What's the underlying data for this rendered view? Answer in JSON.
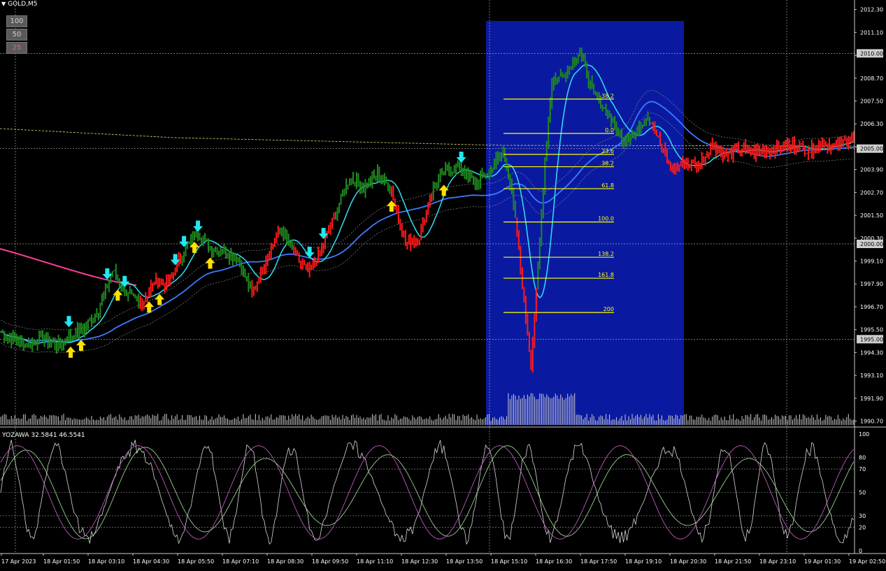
{
  "window": {
    "title": "GOLD,M5"
  },
  "level_buttons": [
    "100",
    "50",
    "25"
  ],
  "colors": {
    "background": "#000000",
    "bull_bar": "#1f8a1f",
    "bear_bar": "#ff1a1a",
    "fast_ma": "#32e0f0",
    "slow_ma": "#3b7cff",
    "pink_ma": "#ff3d9a",
    "highlight": "#0a1aa0",
    "fib": "#ffff00",
    "arrow_up": "#ffe000",
    "arrow_down": "#20e8f0",
    "volume": "#d0d0d0",
    "stoch_main": "#d8d8d8",
    "stoch_signal": "#cc66cc",
    "stoch_green": "#a8e8a0"
  },
  "price_axis": {
    "ticks": [
      "2012.30",
      "2011.10",
      "2009.90",
      "2008.70",
      "2007.50",
      "2006.30",
      "2005.10",
      "2003.90",
      "2002.70",
      "2001.50",
      "2000.30",
      "1999.10",
      "1997.90",
      "1996.70",
      "1995.50",
      "1994.30",
      "1993.10",
      "1991.90",
      "1990.70"
    ],
    "marked_levels": [
      "2010.00",
      "2005.00",
      "2000.00",
      "1995.00"
    ]
  },
  "time_axis": [
    "17 Apr 2023",
    "18 Apr 01:50",
    "18 Apr 03:10",
    "18 Apr 04:30",
    "18 Apr 05:50",
    "18 Apr 07:10",
    "18 Apr 08:30",
    "18 Apr 09:50",
    "18 Apr 11:10",
    "18 Apr 12:30",
    "18 Apr 13:50",
    "18 Apr 15:10",
    "18 Apr 16:30",
    "18 Apr 17:50",
    "18 Apr 19:10",
    "18 Apr 20:30",
    "18 Apr 21:50",
    "18 Apr 23:10",
    "19 Apr 01:30",
    "19 Apr 02:50"
  ],
  "fibonacci": {
    "levels": [
      {
        "label": "-38.2",
        "price": 2007.6
      },
      {
        "label": "0.0",
        "price": 2005.8
      },
      {
        "label": "23.6",
        "price": 2004.7
      },
      {
        "label": "38.2",
        "price": 2004.05
      },
      {
        "label": "61.8",
        "price": 2002.9
      },
      {
        "label": "100.0",
        "price": 2001.15
      },
      {
        "label": "138.2",
        "price": 1999.3
      },
      {
        "label": "161.8",
        "price": 1998.2
      },
      {
        "label": "200",
        "price": 1996.4
      }
    ]
  },
  "indicator": {
    "label": "YOZAWA 32.5841 46.5541",
    "scale": [
      "100",
      "80",
      "70",
      "50",
      "30",
      "20",
      "0"
    ]
  },
  "chart_data": {
    "type": "candlestick",
    "symbol": "GOLD",
    "timeframe": "M5",
    "ylim": [
      1990.5,
      2012.8
    ],
    "anchors": [
      [
        0,
        1995.4,
        "g"
      ],
      [
        8,
        1994.9,
        "g"
      ],
      [
        16,
        1994.7,
        "g"
      ],
      [
        24,
        1995.1,
        "g"
      ],
      [
        32,
        1994.6,
        "g"
      ],
      [
        40,
        1995.2,
        "g"
      ],
      [
        48,
        1995.6,
        "g"
      ],
      [
        56,
        1996.6,
        "g"
      ],
      [
        64,
        1998.6,
        "g"
      ],
      [
        72,
        1997.4,
        "g"
      ],
      [
        80,
        1996.8,
        "r"
      ],
      [
        88,
        1998.0,
        "r"
      ],
      [
        96,
        1997.9,
        "r"
      ],
      [
        104,
        1999.5,
        "g"
      ],
      [
        112,
        2000.6,
        "g"
      ],
      [
        120,
        1999.8,
        "g"
      ],
      [
        128,
        1999.6,
        "g"
      ],
      [
        136,
        1999.3,
        "g"
      ],
      [
        144,
        1997.3,
        "r"
      ],
      [
        152,
        1999.2,
        "r"
      ],
      [
        160,
        2000.8,
        "g"
      ],
      [
        168,
        1999.5,
        "r"
      ],
      [
        176,
        1998.5,
        "r"
      ],
      [
        184,
        1999.7,
        "r"
      ],
      [
        192,
        2001.6,
        "g"
      ],
      [
        200,
        2003.5,
        "g"
      ],
      [
        208,
        2002.9,
        "g"
      ],
      [
        216,
        2003.7,
        "g"
      ],
      [
        224,
        2002.8,
        "r"
      ],
      [
        232,
        2000.0,
        "r"
      ],
      [
        240,
        2000.4,
        "r"
      ],
      [
        248,
        2003.0,
        "g"
      ],
      [
        256,
        2003.9,
        "g"
      ],
      [
        264,
        2004.0,
        "g"
      ],
      [
        272,
        2003.2,
        "g"
      ],
      [
        280,
        2003.8,
        "g"
      ],
      [
        288,
        2004.9,
        "g"
      ],
      [
        292,
        2003.2,
        "g"
      ],
      [
        296,
        2000.5,
        "r"
      ],
      [
        300,
        1997.0,
        "r"
      ],
      [
        304,
        1993.7,
        "r"
      ],
      [
        308,
        1998.6,
        "g"
      ],
      [
        312,
        2004.5,
        "g"
      ],
      [
        316,
        2008.5,
        "g"
      ],
      [
        324,
        2009.0,
        "g"
      ],
      [
        332,
        2010.1,
        "g"
      ],
      [
        340,
        2007.8,
        "g"
      ],
      [
        348,
        2006.9,
        "g"
      ],
      [
        356,
        2005.5,
        "g"
      ],
      [
        364,
        2005.8,
        "g"
      ],
      [
        370,
        2006.8,
        "g"
      ],
      [
        374,
        2006.3,
        "r"
      ],
      [
        378,
        2005.2,
        "r"
      ],
      [
        384,
        2004.0,
        "r"
      ],
      [
        392,
        2004.2,
        "r"
      ],
      [
        400,
        2004.1,
        "r"
      ],
      [
        408,
        2005.2,
        "r"
      ],
      [
        416,
        2004.6,
        "r"
      ],
      [
        424,
        2005.0,
        "r"
      ],
      [
        432,
        2004.8,
        "r"
      ],
      [
        440,
        2004.9,
        "r"
      ],
      [
        448,
        2005.1,
        "r"
      ],
      [
        456,
        2005.2,
        "r"
      ],
      [
        464,
        2004.9,
        "r"
      ],
      [
        472,
        2005.3,
        "r"
      ],
      [
        480,
        2005.1,
        "r"
      ],
      [
        486,
        2005.6,
        "r"
      ]
    ],
    "buy_signals": [
      40,
      46,
      67,
      85,
      91,
      111,
      120,
      224,
      254
    ],
    "sell_signals": [
      39,
      61,
      71,
      100,
      105,
      113,
      177,
      185,
      264
    ],
    "highlight_range": {
      "start": "18 Apr 15:00",
      "end": "18 Apr 19:30"
    }
  }
}
